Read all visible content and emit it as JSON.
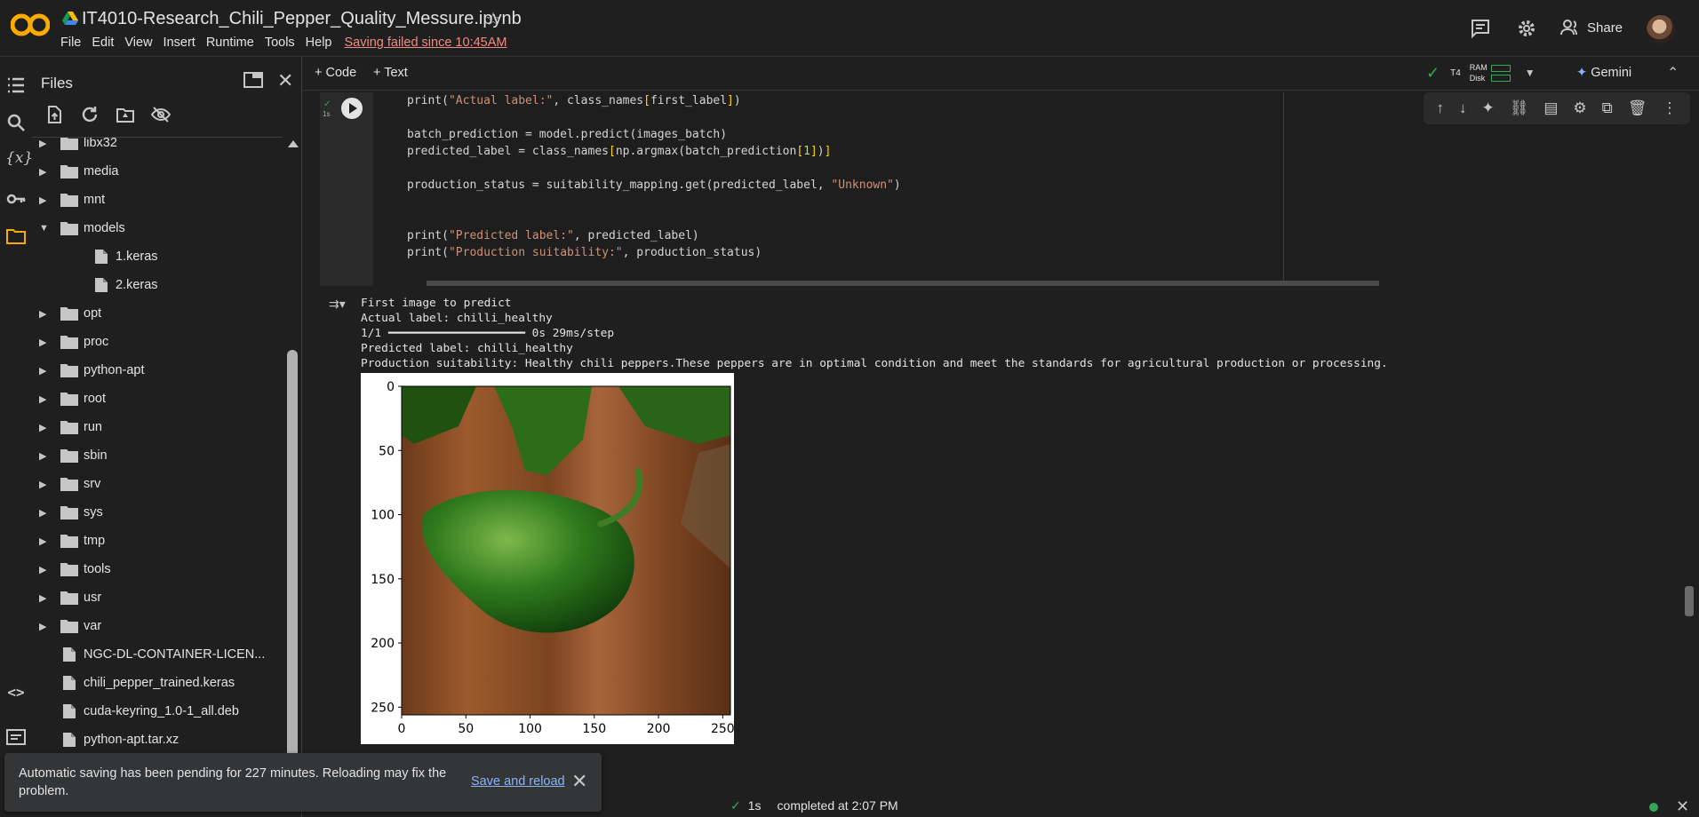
{
  "header": {
    "notebook_title": "IT4010-Research_Chili_Pepper_Quality_Messure.ipynb",
    "menu": [
      "File",
      "Edit",
      "View",
      "Insert",
      "Runtime",
      "Tools",
      "Help"
    ],
    "save_warning": "Saving failed since 10:45AM",
    "share_label": "Share"
  },
  "toolbar": {
    "add_code": "Code",
    "add_text": "Text",
    "runtime_type": "T4",
    "ram_label": "RAM",
    "disk_label": "Disk",
    "gemini_label": "Gemini"
  },
  "files_panel": {
    "title": "Files",
    "items": [
      {
        "label": "libx32",
        "type": "folder",
        "expanded": false
      },
      {
        "label": "media",
        "type": "folder",
        "expanded": false
      },
      {
        "label": "mnt",
        "type": "folder",
        "expanded": false
      },
      {
        "label": "models",
        "type": "folder",
        "expanded": true
      },
      {
        "label": "1.keras",
        "type": "file",
        "child": true
      },
      {
        "label": "2.keras",
        "type": "file",
        "child": true
      },
      {
        "label": "opt",
        "type": "folder",
        "expanded": false
      },
      {
        "label": "proc",
        "type": "folder",
        "expanded": false
      },
      {
        "label": "python-apt",
        "type": "folder",
        "expanded": false
      },
      {
        "label": "root",
        "type": "folder",
        "expanded": false
      },
      {
        "label": "run",
        "type": "folder",
        "expanded": false
      },
      {
        "label": "sbin",
        "type": "folder",
        "expanded": false
      },
      {
        "label": "srv",
        "type": "folder",
        "expanded": false
      },
      {
        "label": "sys",
        "type": "folder",
        "expanded": false
      },
      {
        "label": "tmp",
        "type": "folder",
        "expanded": false
      },
      {
        "label": "tools",
        "type": "folder",
        "expanded": false
      },
      {
        "label": "usr",
        "type": "folder",
        "expanded": false
      },
      {
        "label": "var",
        "type": "folder",
        "expanded": false
      },
      {
        "label": "NGC-DL-CONTAINER-LICEN...",
        "type": "file"
      },
      {
        "label": "chili_pepper_trained.keras",
        "type": "file"
      },
      {
        "label": "cuda-keyring_1.0-1_all.deb",
        "type": "file"
      },
      {
        "label": "python-apt.tar.xz",
        "type": "file"
      }
    ]
  },
  "cell": {
    "exec_time": "1s",
    "code_lines": [
      "print(\"Actual label:\", class_names[first_label])",
      "",
      "batch_prediction = model.predict(images_batch)",
      "predicted_label = class_names[np.argmax(batch_prediction[1])]",
      "",
      "production_status = suitability_mapping.get(predicted_label, \"Unknown\")",
      "",
      "",
      "print(\"Predicted label:\", predicted_label)",
      "print(\"Production suitability:\", production_status)"
    ]
  },
  "output": {
    "lines": [
      "First image to predict",
      "Actual label: chilli_healthy",
      "1/1 ━━━━━━━━━━━━━━━━━━━━ 0s 29ms/step",
      "Predicted label: chilli_healthy",
      "Production suitability: Healthy chili peppers.These peppers are in optimal condition and meet the standards for agricultural production or processing."
    ],
    "plot": {
      "x_ticks": [
        "0",
        "50",
        "100",
        "150",
        "200",
        "250"
      ],
      "y_ticks": [
        "0",
        "50",
        "100",
        "150",
        "200",
        "250"
      ]
    }
  },
  "toast": {
    "message": "Automatic saving has been pending for 227 minutes. Reloading may fix the problem.",
    "action": "Save and reload"
  },
  "status": {
    "time": "1s",
    "completed": "completed at 2:07 PM"
  }
}
